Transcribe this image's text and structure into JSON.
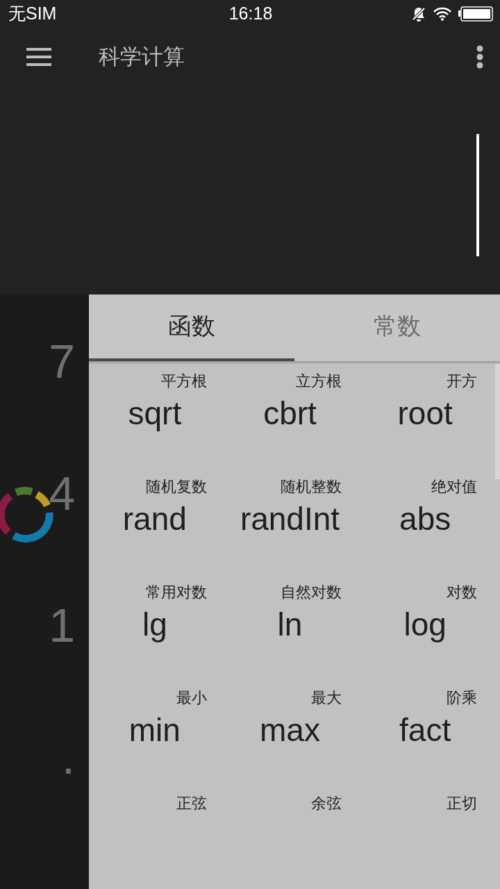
{
  "status_bar": {
    "carrier": "无SIM",
    "time": "16:18"
  },
  "toolbar": {
    "title": "科学计算"
  },
  "display": {
    "cursor": true
  },
  "keypad": {
    "keys": [
      "7",
      "4",
      "1",
      "."
    ]
  },
  "tabs": [
    {
      "label": "函数",
      "selected": true
    },
    {
      "label": "常数",
      "selected": false
    }
  ],
  "functions": [
    {
      "hint": "平方根",
      "name": "sqrt"
    },
    {
      "hint": "立方根",
      "name": "cbrt"
    },
    {
      "hint": "开方",
      "name": "root"
    },
    {
      "hint": "随机复数",
      "name": "rand"
    },
    {
      "hint": "随机整数",
      "name": "randInt"
    },
    {
      "hint": "绝对值",
      "name": "abs"
    },
    {
      "hint": "常用对数",
      "name": "lg"
    },
    {
      "hint": "自然对数",
      "name": "ln"
    },
    {
      "hint": "对数",
      "name": "log"
    },
    {
      "hint": "最小",
      "name": "min"
    },
    {
      "hint": "最大",
      "name": "max"
    },
    {
      "hint": "阶乘",
      "name": "fact"
    },
    {
      "hint": "正弦"
    },
    {
      "hint": "余弦"
    },
    {
      "hint": "正切"
    }
  ]
}
